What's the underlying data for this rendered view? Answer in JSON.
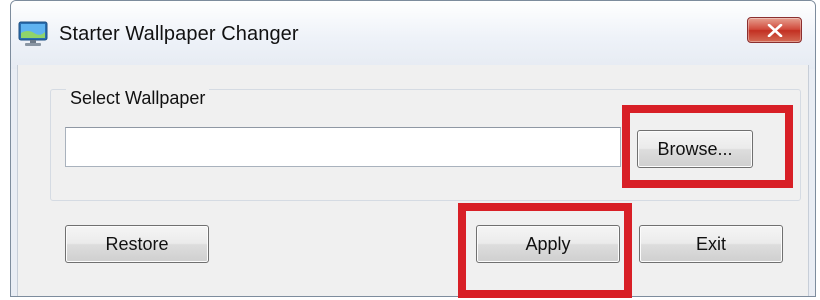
{
  "window": {
    "title": "Starter Wallpaper Changer",
    "icon": "monitor-icon",
    "close_icon": "close-icon"
  },
  "wallpaper_group": {
    "label": "Select Wallpaper",
    "path_value": "",
    "browse_label": "Browse..."
  },
  "buttons": {
    "restore_label": "Restore",
    "apply_label": "Apply",
    "exit_label": "Exit"
  },
  "annotations": {
    "highlight_color": "#d81f26",
    "highlighted": [
      "Browse...",
      "Apply"
    ]
  }
}
